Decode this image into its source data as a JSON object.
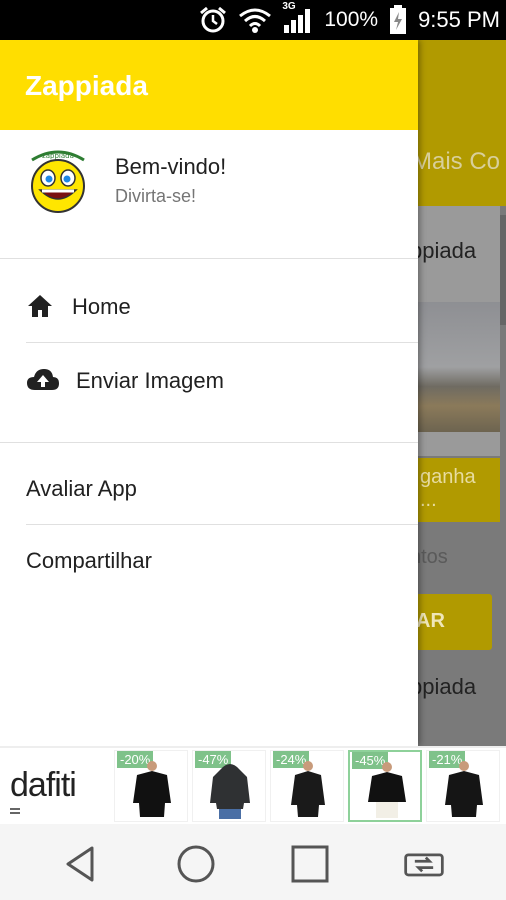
{
  "status_bar": {
    "network_type": "3G",
    "battery_percent": "100%",
    "time": "9:55 PM"
  },
  "app_background": {
    "tab_text": "Mais Co",
    "card_title": "ppiada",
    "card_footer_line1": "ganha",
    "card_footer_line2": "...",
    "grey_text": "ntos",
    "button_text": "AR",
    "card2_title": "ppiada",
    "colors": {
      "toolbar": "#b19a00"
    }
  },
  "drawer": {
    "title": "Zappiada",
    "avatar_icon": "smiley-icon",
    "welcome": "Bem-vindo!",
    "subtitle": "Divirta-se!",
    "items": [
      {
        "label": "Home",
        "icon": "home-icon"
      },
      {
        "label": "Enviar Imagem",
        "icon": "cloud-upload-icon"
      },
      {
        "label": "Avaliar App"
      },
      {
        "label": "Compartilhar"
      }
    ],
    "colors": {
      "header": "#ffde00"
    }
  },
  "ad": {
    "brand": "dafiti",
    "products": [
      {
        "discount": "-20%"
      },
      {
        "discount": "-47%"
      },
      {
        "discount": "-24%"
      },
      {
        "discount": "-45%"
      },
      {
        "discount": "-21%"
      }
    ]
  },
  "nav_bar": {
    "buttons": [
      "back-icon",
      "home-circle-icon",
      "recents-icon",
      "switch-apps-icon"
    ]
  }
}
